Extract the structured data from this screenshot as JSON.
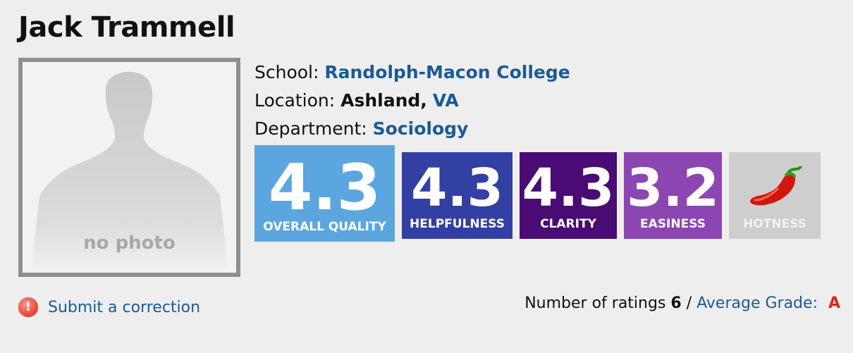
{
  "professor": {
    "name": "Jack Trammell",
    "photo_caption": "no photo"
  },
  "details": {
    "school_label": "School:",
    "school_value": "Randolph-Macon College",
    "location_label": "Location:",
    "location_city": "Ashland,",
    "location_state": "VA",
    "department_label": "Department:",
    "department_value": "Sociology"
  },
  "ratings": {
    "overall": {
      "value": "4.3",
      "label": "OVERALL QUALITY"
    },
    "helpfulness": {
      "value": "4.3",
      "label": "HELPFULNESS"
    },
    "clarity": {
      "value": "4.3",
      "label": "CLARITY"
    },
    "easiness": {
      "value": "3.2",
      "label": "EASINESS"
    },
    "hotness": {
      "label": "HOTNESS",
      "icon": "chili-pepper-icon"
    }
  },
  "footer": {
    "correction_label": "Submit a correction",
    "correction_icon": "!",
    "num_ratings_label": "Number of ratings",
    "num_ratings_value": "6",
    "separator": "/",
    "avg_grade_label": "Average Grade:",
    "avg_grade_value": "A"
  },
  "colors": {
    "overall": "#5ba6df",
    "helpfulness": "#3340a3",
    "clarity": "#4a0b74",
    "easiness": "#8c46b1",
    "hotness": "#cecece",
    "link": "#1b5a96",
    "grade": "#e0241b"
  }
}
